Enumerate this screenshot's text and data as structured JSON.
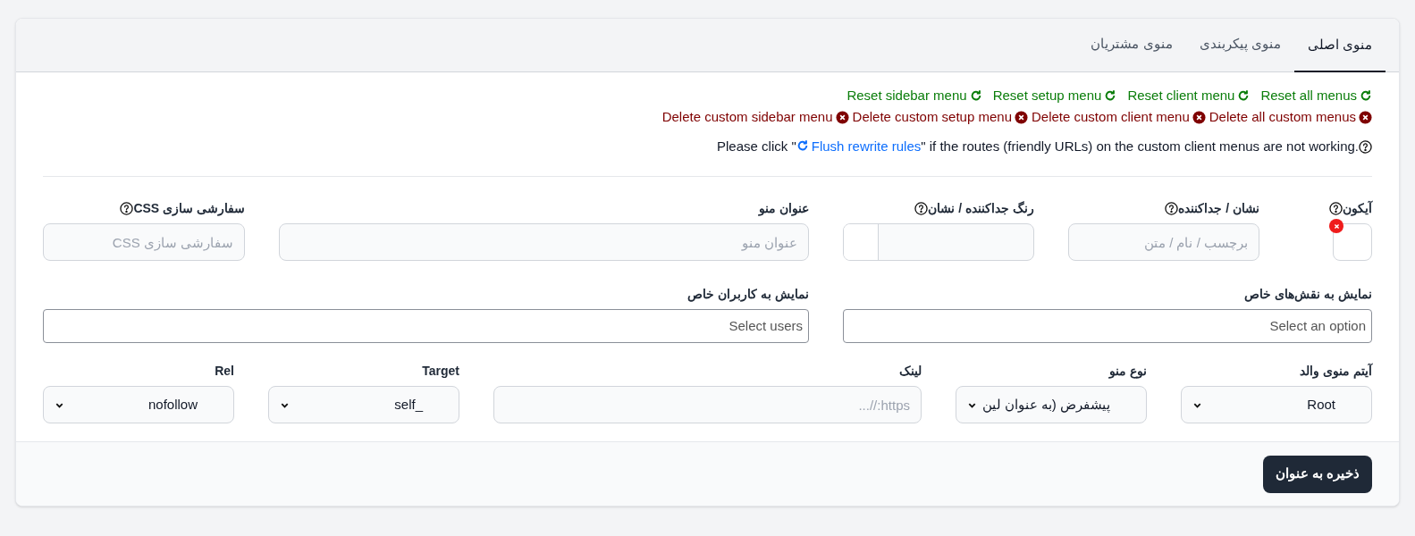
{
  "tabs": [
    {
      "label": "منوی اصلی",
      "selected": true
    },
    {
      "label": "منوی پیکربندی",
      "selected": false
    },
    {
      "label": "منوی مشتریان",
      "selected": false
    }
  ],
  "reset_links": [
    "Reset all menus",
    "Reset client menu",
    "Reset setup menu",
    "Reset sidebar menu"
  ],
  "delete_links": [
    "Delete all custom menus",
    "Delete custom client menu",
    "Delete custom setup menu",
    "Delete custom sidebar menu"
  ],
  "notice": {
    "prefix": "Please click \"",
    "link": "Flush rewrite rules",
    "suffix": "\" if the routes (friendly URLs) on the custom client menus are not working."
  },
  "rows": [
    [
      {
        "kind": "icon",
        "label": "آیکون",
        "help": true,
        "clearable": true
      },
      {
        "kind": "text",
        "label": "نشان / جداکننده",
        "help": true,
        "placeholder": "برچسب / نام / متن"
      },
      {
        "kind": "color",
        "label": "رنگ جداکننده / نشان",
        "help": true
      },
      {
        "kind": "text",
        "label": "عنوان منو",
        "help": false,
        "placeholder": "عنوان منو"
      },
      {
        "kind": "text",
        "label": "سفارشی سازی CSS",
        "help": true,
        "placeholder": "سفارشی سازی CSS"
      }
    ],
    [
      {
        "kind": "multiselect",
        "label": "نمایش به نقش‌های خاص",
        "help": false,
        "placeholder": "Select an option"
      },
      {
        "kind": "multiselect",
        "label": "نمایش به کاربران خاص",
        "help": false,
        "placeholder": "Select users"
      }
    ],
    [
      {
        "kind": "select",
        "label": "آیتم منوی والد",
        "help": false,
        "value": "Root"
      },
      {
        "kind": "select",
        "label": "نوع منو",
        "help": false,
        "value": "پیشفرض (به عنوان لین"
      },
      {
        "kind": "text",
        "label": "لینک",
        "help": false,
        "placeholder": "https://..."
      },
      {
        "kind": "select",
        "label": "Target",
        "help": false,
        "value": "_self"
      },
      {
        "kind": "select",
        "label": "Rel",
        "help": false,
        "value": "nofollow"
      }
    ]
  ],
  "save_button": "ذخیره به عنوان"
}
